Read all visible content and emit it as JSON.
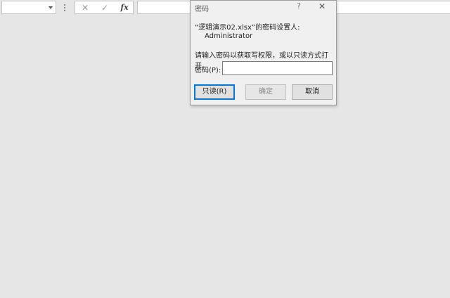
{
  "formula_bar": {
    "name_box_value": "",
    "cancel_glyph": "✕",
    "enter_glyph": "✓",
    "fx_label": "fx",
    "formula_value": ""
  },
  "dialog": {
    "title": "密码",
    "help_glyph": "?",
    "close_glyph": "✕",
    "message_line1": "“逻辑演示02.xlsx”的密码设置人:",
    "owner": "Administrator",
    "message_line2": "请输入密码以获取写权限，或以只读方式打开。",
    "password_label": "密码(P):",
    "password_value": "",
    "buttons": {
      "readonly": "只读(R)",
      "ok": "确定",
      "cancel": "取消"
    }
  }
}
